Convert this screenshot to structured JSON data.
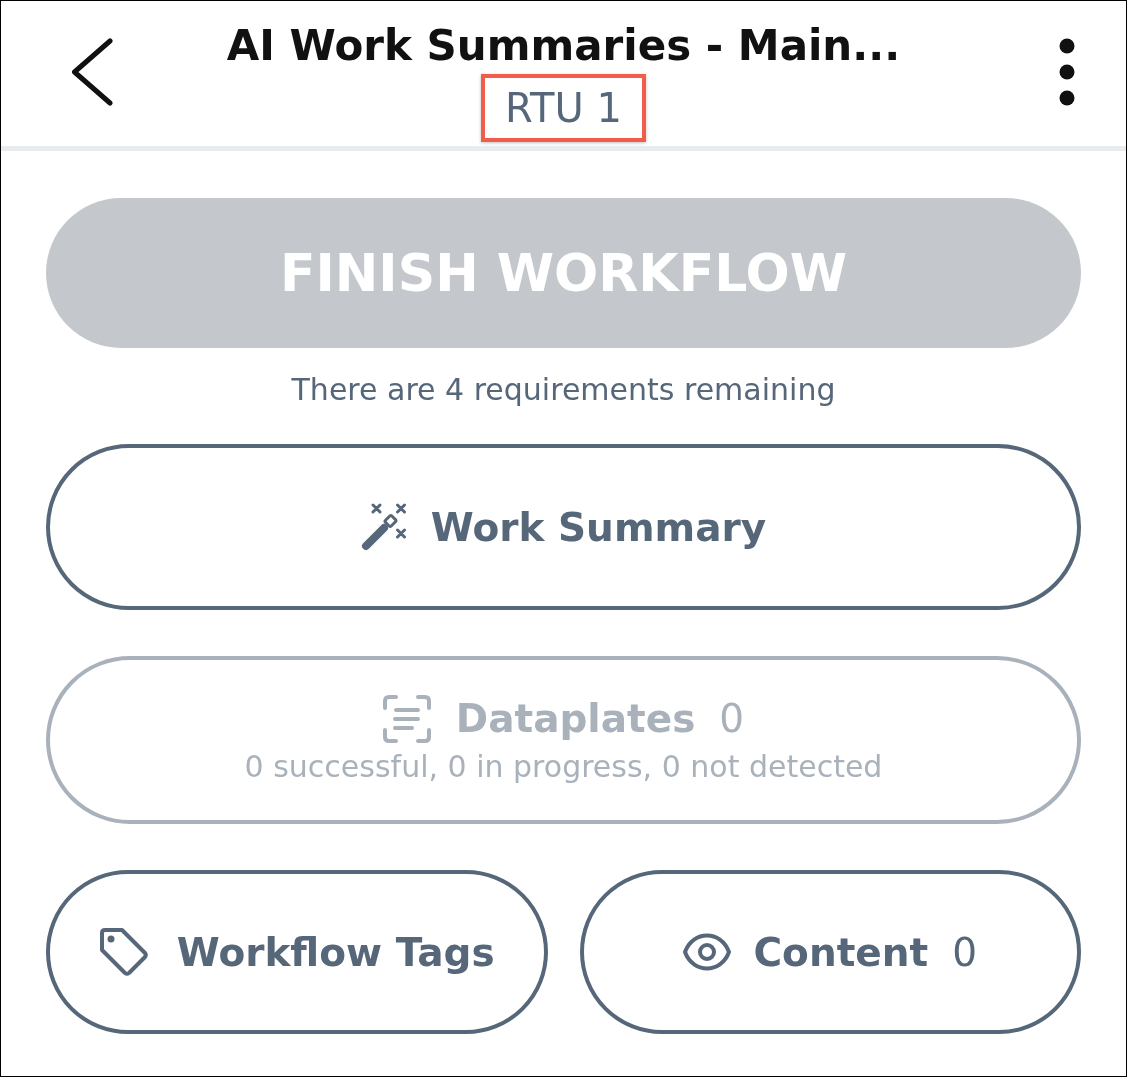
{
  "header": {
    "title": "AI Work Summaries - Main...",
    "subtitle": "RTU 1",
    "subtitle_highlighted": true
  },
  "finish_button": {
    "label": "FINISH WORKFLOW",
    "disabled": true
  },
  "requirements_note": "There are 4 requirements remaining",
  "work_summary_button": {
    "label": "Work Summary"
  },
  "dataplates_button": {
    "label": "Dataplates",
    "count": "0",
    "detail": "0 successful, 0 in progress, 0 not detected",
    "disabled": true
  },
  "workflow_tags_button": {
    "label": "Workflow Tags"
  },
  "content_button": {
    "label": "Content",
    "count": "0"
  }
}
